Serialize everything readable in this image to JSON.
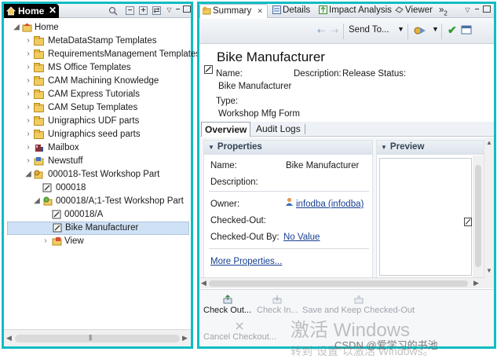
{
  "left_pane": {
    "tab_label": "Home",
    "tree": [
      {
        "label": "Home",
        "level": 0,
        "expanded": true,
        "icon": "home-folder-icon"
      },
      {
        "label": "MetaDataStamp Templates",
        "level": 1,
        "expanded": false,
        "icon": "folder-icon"
      },
      {
        "label": "RequirementsManagement Templates",
        "level": 1,
        "expanded": false,
        "icon": "folder-icon"
      },
      {
        "label": "MS Office Templates",
        "level": 1,
        "expanded": false,
        "icon": "folder-icon"
      },
      {
        "label": "CAM Machining Knowledge",
        "level": 1,
        "expanded": false,
        "icon": "folder-icon"
      },
      {
        "label": "CAM Express Tutorials",
        "level": 1,
        "expanded": false,
        "icon": "folder-icon"
      },
      {
        "label": "CAM Setup Templates",
        "level": 1,
        "expanded": false,
        "icon": "folder-icon"
      },
      {
        "label": "Unigraphics UDF parts",
        "level": 1,
        "expanded": false,
        "icon": "folder-icon"
      },
      {
        "label": "Unigraphics seed parts",
        "level": 1,
        "expanded": false,
        "icon": "folder-icon"
      },
      {
        "label": "Mailbox",
        "level": 1,
        "expanded": false,
        "icon": "mailbox-icon"
      },
      {
        "label": "Newstuff",
        "level": 1,
        "expanded": false,
        "icon": "newstuff-folder-icon"
      },
      {
        "label": "000018-Test Workshop Part",
        "level": 1,
        "expanded": true,
        "icon": "item-icon"
      },
      {
        "label": "000018",
        "level": 2,
        "expanded": null,
        "icon": "form-icon"
      },
      {
        "label": "000018/A;1-Test Workshop Part",
        "level": 2,
        "expanded": true,
        "icon": "item-revision-icon"
      },
      {
        "label": "000018/A",
        "level": 3,
        "expanded": null,
        "icon": "form-icon"
      },
      {
        "label": "Bike Manufacturer",
        "level": 3,
        "expanded": null,
        "icon": "form-icon",
        "selected": true
      },
      {
        "label": "View",
        "level": 3,
        "expanded": false,
        "icon": "view-icon"
      }
    ]
  },
  "right_pane": {
    "tabs": [
      {
        "label": "Summary",
        "active": true
      },
      {
        "label": "Details",
        "active": false
      },
      {
        "label": "Impact Analysis",
        "active": false
      },
      {
        "label": "Viewer",
        "active": false
      }
    ],
    "overflow_label": "»",
    "overflow_count": "2",
    "toolbar": {
      "send_to": "Send To..."
    },
    "header": {
      "title": "Bike Manufacturer",
      "name_label": "Name:",
      "name_value": "Bike Manufacturer",
      "description_label": "Description:",
      "release_status_label": "Release Status:",
      "type_label": "Type:",
      "type_value": "Workshop Mfg Form"
    },
    "subtabs": [
      {
        "label": "Overview",
        "active": true
      },
      {
        "label": "Audit Logs",
        "active": false
      }
    ],
    "properties": {
      "title": "Properties",
      "rows": [
        {
          "label": "Name:",
          "value": "Bike Manufacturer"
        },
        {
          "label": "Description:",
          "value": ""
        },
        {
          "label": "Owner:",
          "value": "infodba (infodba)"
        },
        {
          "label": "Checked-Out:",
          "value": ""
        },
        {
          "label": "Checked-Out By:",
          "value": "No Value"
        }
      ],
      "more_link": "More Properties..."
    },
    "preview": {
      "title": "Preview"
    },
    "actions": [
      {
        "label": "Check Out...",
        "enabled": true
      },
      {
        "label": "Check In...",
        "enabled": false
      },
      {
        "label": "Save and Keep Checked-Out",
        "enabled": false
      },
      {
        "label": "Cancel Checkout...",
        "enabled": false
      }
    ]
  },
  "overlay": {
    "watermark_line1": "激活 Windows",
    "watermark_line2": "转到\"设置\"以激活 Windows。",
    "csdn": "CSDN @爱学习的书池"
  },
  "colors": {
    "focus_border": "#10bcc4",
    "selection": "#cfe1f5",
    "link": "#173f91"
  }
}
